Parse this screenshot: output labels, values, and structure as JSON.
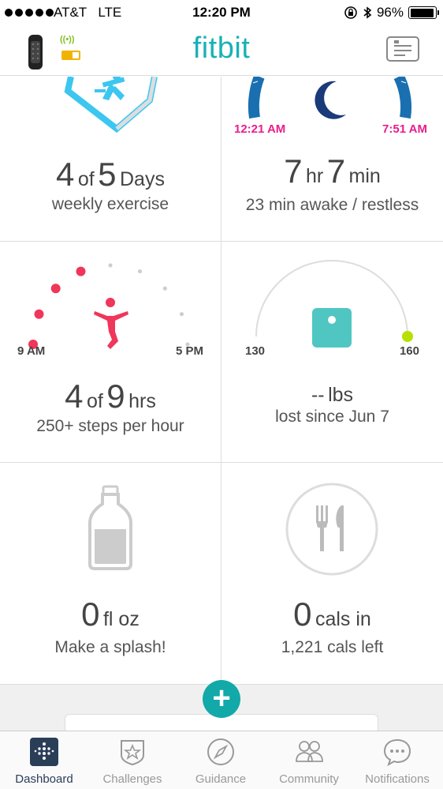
{
  "status_bar": {
    "carrier": "AT&T",
    "network": "LTE",
    "time": "12:20 PM",
    "battery": "96%",
    "battery_level": 0.96
  },
  "header": {
    "logo": "fitbit",
    "sync_glyph": "((•))"
  },
  "exercise": {
    "count": "4",
    "of": "of",
    "total": "5",
    "unit": "Days",
    "label": "weekly exercise"
  },
  "sleep": {
    "start": "12:21 AM",
    "end": "7:51 AM",
    "hours": "7",
    "hours_unit": "hr",
    "minutes": "7",
    "minutes_unit": "min",
    "label": "23 min awake / restless"
  },
  "hourly": {
    "start": "9 AM",
    "end": "5 PM",
    "count": "4",
    "of": "of",
    "total": "9",
    "unit": "hrs",
    "label": "250+ steps per hour",
    "hours_met": 4,
    "hours_total": 9
  },
  "weight": {
    "min": "130",
    "max": "160",
    "value": "--",
    "unit": "lbs",
    "label": "lost since Jun 7"
  },
  "water": {
    "value": "0",
    "unit": "fl oz",
    "label": "Make a splash!"
  },
  "food": {
    "value": "0",
    "unit": "cals in",
    "label": "1,221 cals left"
  },
  "fab": {
    "label": "+"
  },
  "tabs": [
    {
      "label": "Dashboard",
      "icon": "dashboard-icon",
      "active": true
    },
    {
      "label": "Challenges",
      "icon": "star-badge-icon",
      "active": false
    },
    {
      "label": "Guidance",
      "icon": "compass-icon",
      "active": false
    },
    {
      "label": "Community",
      "icon": "people-icon",
      "active": false
    },
    {
      "label": "Notifications",
      "icon": "chat-bubble-icon",
      "active": false
    }
  ],
  "colors": {
    "teal": "#19b1b5",
    "pink": "#e91e8c",
    "red": "#f0365a",
    "blue": "#1a6fb0",
    "cyan": "#3cc6f0",
    "lime": "#b5e000",
    "navy": "#2a3e58"
  }
}
